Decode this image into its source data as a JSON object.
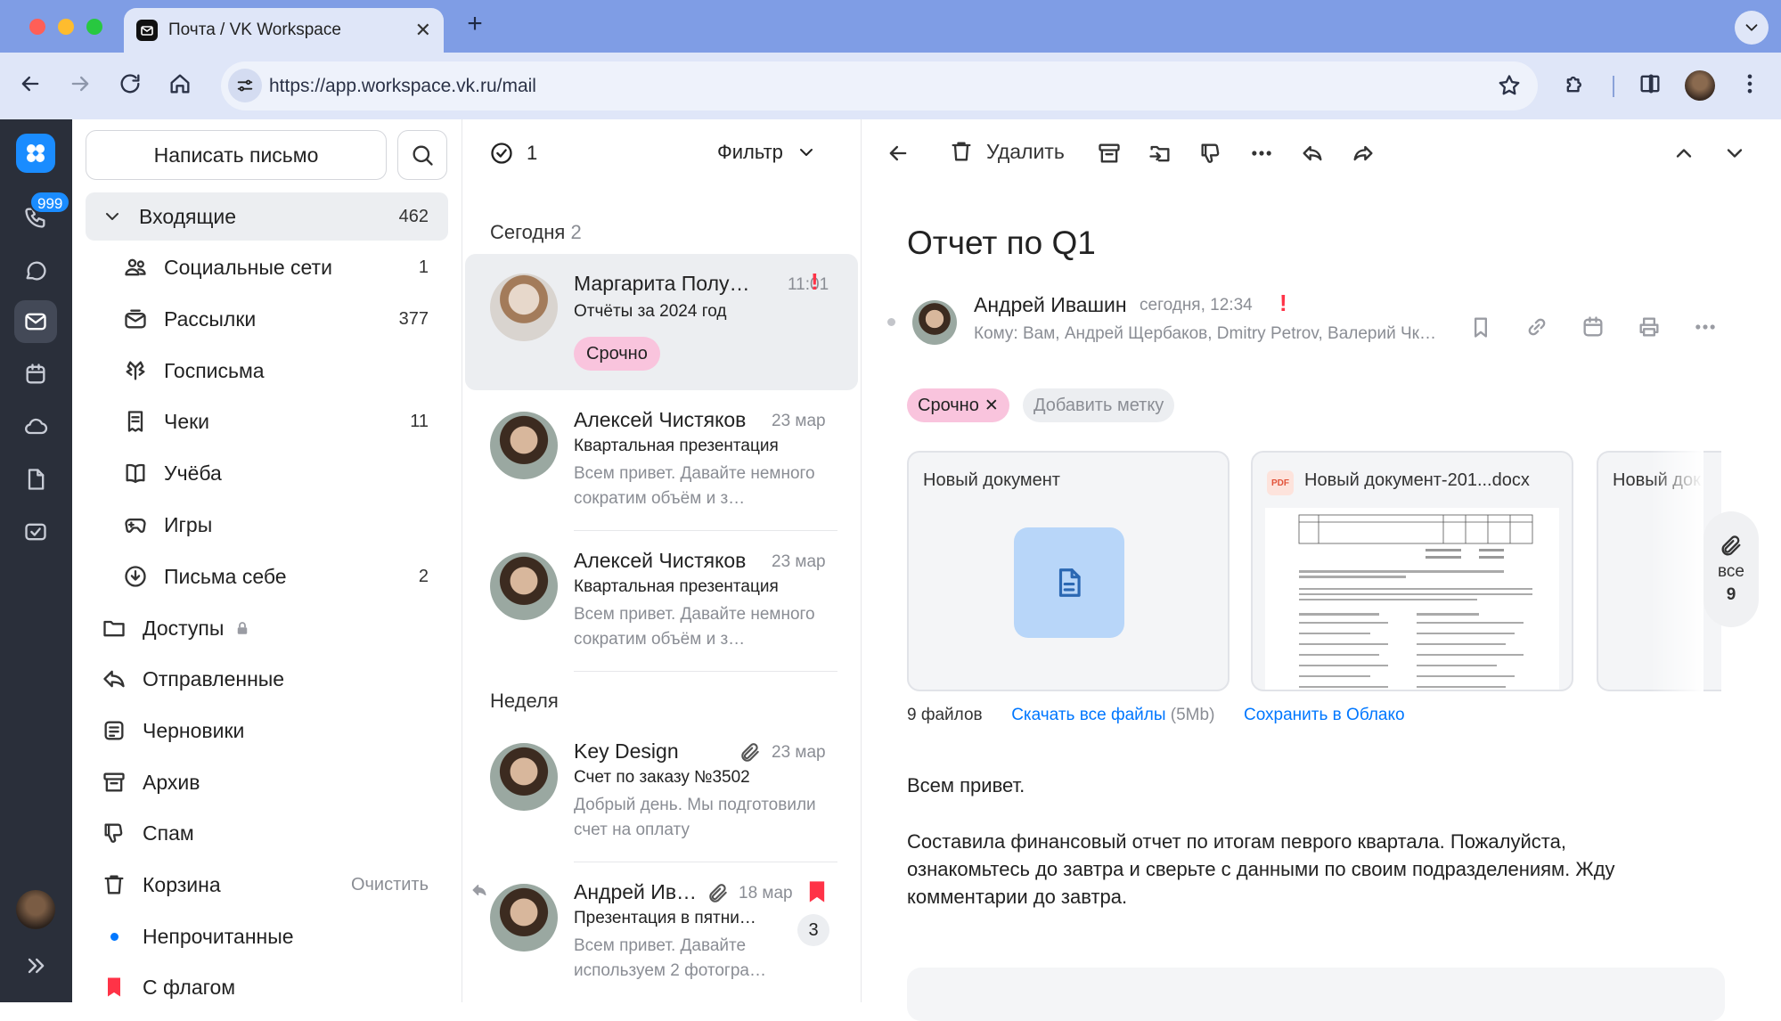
{
  "browser": {
    "tab_title": "Почта / VK Workspace",
    "url": "https://app.workspace.vk.ru/mail"
  },
  "rail": {
    "badge": "999"
  },
  "folders": {
    "compose_label": "Написать письмо",
    "items": [
      {
        "label": "Входящие",
        "count": "462",
        "icon": "chevron-down-icon"
      },
      {
        "label": "Социальные сети",
        "count": "1",
        "icon": "people-icon"
      },
      {
        "label": "Рассылки",
        "count": "377",
        "icon": "newsletter-icon"
      },
      {
        "label": "Госписьма",
        "count": "",
        "icon": "emblem-icon"
      },
      {
        "label": "Чеки",
        "count": "11",
        "icon": "receipt-icon"
      },
      {
        "label": "Учёба",
        "count": "",
        "icon": "book-icon"
      },
      {
        "label": "Игры",
        "count": "",
        "icon": "gamepad-icon"
      },
      {
        "label": "Письма себе",
        "count": "2",
        "icon": "self-mail-icon"
      },
      {
        "label": "Доступы",
        "count": "",
        "icon": "folder-icon"
      },
      {
        "label": "Отправленные",
        "count": "",
        "icon": "sent-icon"
      },
      {
        "label": "Черновики",
        "count": "",
        "icon": "draft-icon"
      },
      {
        "label": "Архив",
        "count": "",
        "icon": "archive-icon"
      },
      {
        "label": "Спам",
        "count": "",
        "icon": "spam-icon"
      },
      {
        "label": "Корзина",
        "count": "",
        "icon": "trash-icon"
      },
      {
        "label": "Непрочитанные",
        "count": "",
        "icon": "unread-dot-icon"
      },
      {
        "label": "С флагом",
        "count": "",
        "icon": "flag-icon"
      }
    ],
    "trash_action": "Очистить"
  },
  "list": {
    "selected_count": "1",
    "filter_label": "Фильтр",
    "section_today": "Сегодня",
    "section_today_count": "2",
    "section_week": "Неделя",
    "mails": [
      {
        "from": "Маргарита Полу…",
        "time": "11:01",
        "subject": "Отчёты за 2024 год",
        "preview": "",
        "tag": "Срочно"
      },
      {
        "from": "Алексей Чистяков",
        "time": "23 мар",
        "subject": "Квартальная презентация",
        "preview": "Всем привет. Давайте немного сократим объём и з…"
      },
      {
        "from": "Алексей Чистяков",
        "time": "23 мар",
        "subject": "Квартальная презентация",
        "preview": "Всем привет. Давайте немного сократим объём и з…"
      },
      {
        "from": "Key Design",
        "time": "23 мар",
        "subject": "Счет по заказу №3502",
        "preview": "Добрый день. Мы подготовили счет на оплату"
      },
      {
        "from": "Андрей Ив…",
        "time": "18 мар",
        "subject": "Презентация в пятни…",
        "preview": "Всем привет. Давайте используем 2 фотогра…",
        "thread_count": "3"
      }
    ]
  },
  "reader": {
    "delete_label": "Удалить",
    "subject": "Отчет по Q1",
    "sender": "Андрей Ивашин",
    "date": "сегодня, 12:34",
    "recipients": "Кому: Вам, Андрей Щербаков, Dmitry Petrov, Валерий Чк…",
    "tag": "Срочно",
    "add_tag": "Добавить метку",
    "attachments": [
      {
        "name": "Новый документ"
      },
      {
        "name": "Новый документ-201...docx",
        "badge": "PDF"
      },
      {
        "name": "Новый док"
      }
    ],
    "all_label": "все",
    "all_count": "9",
    "files_count": "9 файлов",
    "download_all": "Скачать все файлы",
    "download_size": "(5Mb)",
    "save_cloud": "Сохранить в Облако",
    "body": [
      "Всем привет.",
      "Составила финансовый отчет по итогам певрого квартала. Пожалуйста, ознакомьтесь до завтра и сверьте с данными по своим подразделениям. Жду комментарии до завтра."
    ]
  },
  "colors": {
    "accent": "#0077ff",
    "urgent_tag_bg": "#f9c4dd",
    "flag_red": "#ff3347",
    "rail_bg": "#2a2f3a",
    "browser_frame": "#7f9de5"
  }
}
